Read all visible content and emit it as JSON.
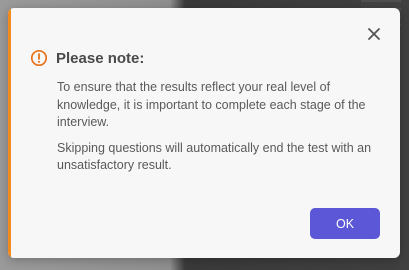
{
  "dialog": {
    "title": "Please note:",
    "paragraphs": [
      "To ensure that the results reflect your real level of knowledge, it is important to complete each stage of the interview.",
      "Skipping questions will automatically end the test with an unsatisfactory result."
    ],
    "ok_label": "OK",
    "icons": {
      "warning": "warning-circle-icon",
      "close": "close-icon"
    }
  },
  "colors": {
    "accent": "#f28a1e",
    "button": "#5b57d6",
    "dialog_bg": "#f7f7f8"
  }
}
